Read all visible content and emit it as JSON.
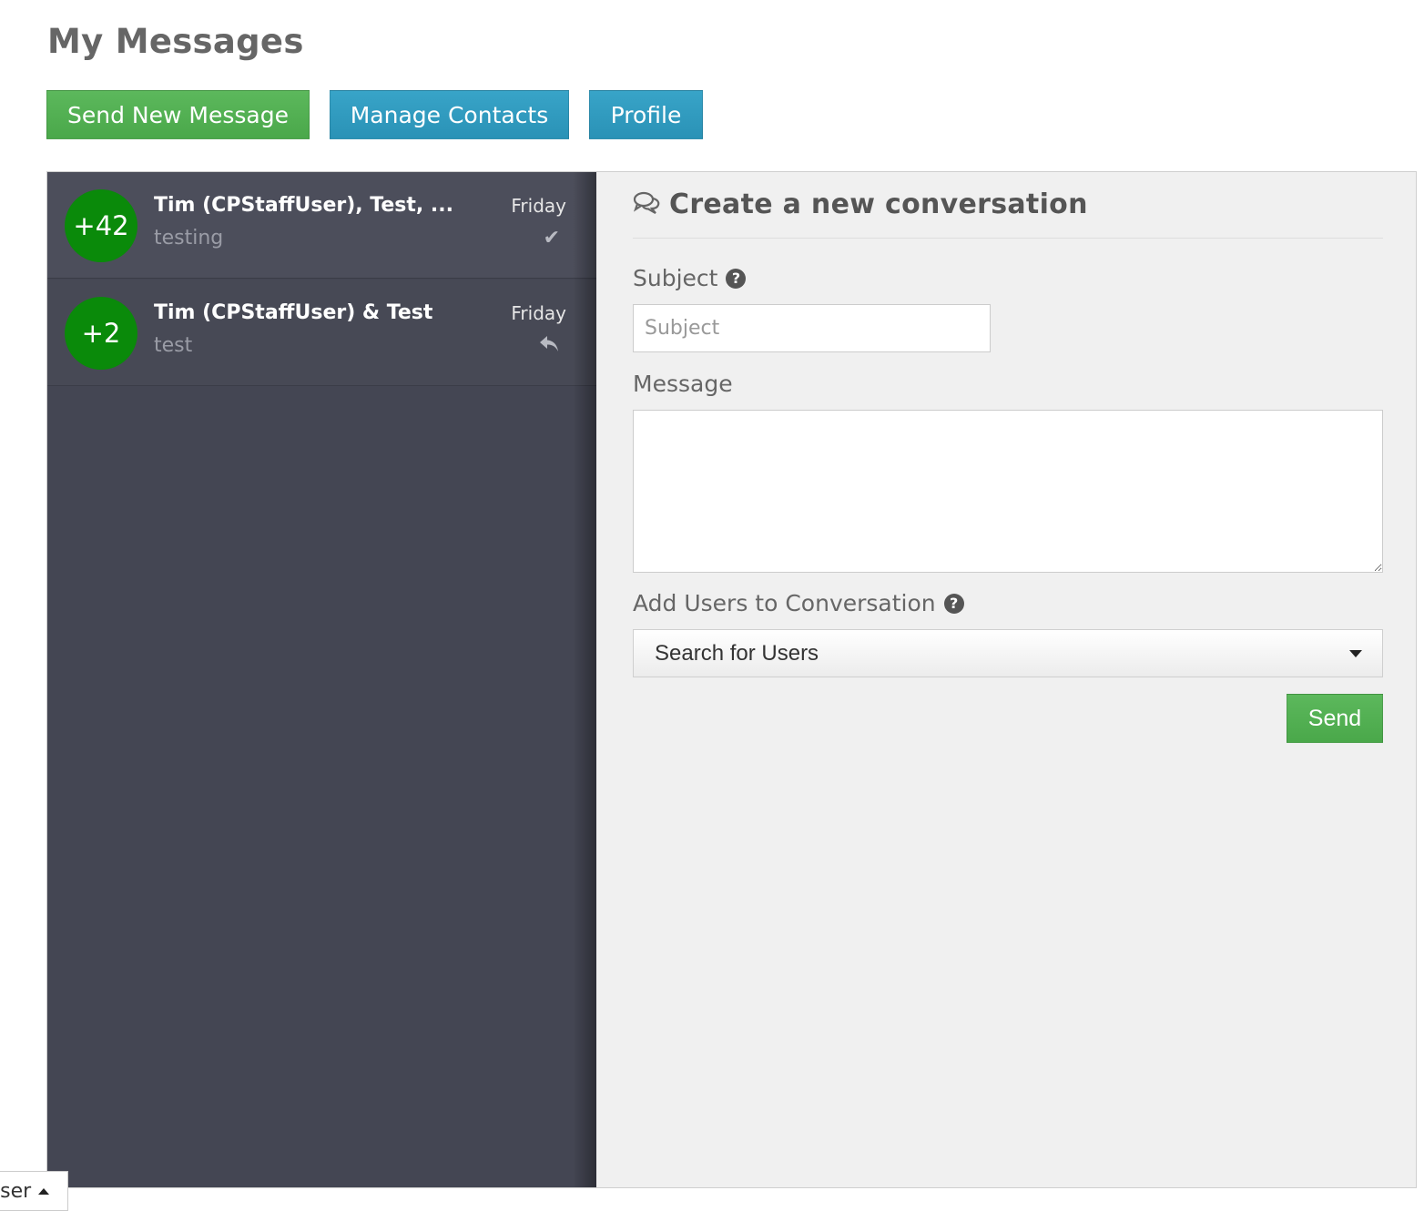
{
  "page": {
    "title": "My Messages"
  },
  "toolbar": {
    "send_new_message": "Send New Message",
    "manage_contacts": "Manage Contacts",
    "profile": "Profile"
  },
  "conversations": [
    {
      "avatar": "+42",
      "name": "Tim (CPStaffUser), Test, ...",
      "preview": "testing",
      "date": "Friday",
      "status_icon": "check-icon"
    },
    {
      "avatar": "+2",
      "name": "Tim (CPStaffUser) & Test",
      "preview": "test",
      "date": "Friday",
      "status_icon": "reply-icon"
    }
  ],
  "compose": {
    "title": "Create a new conversation",
    "title_icon": "comments-icon",
    "subject_label": "Subject",
    "subject_placeholder": "Subject",
    "message_label": "Message",
    "users_label": "Add Users to Conversation",
    "users_select_value": "Search for Users",
    "send_label": "Send"
  },
  "bottom_tab": {
    "label": "User"
  },
  "colors": {
    "success": "#5cb85c",
    "info": "#38a4c8",
    "sidebar": "#444653",
    "avatar": "#0a8a0a"
  }
}
